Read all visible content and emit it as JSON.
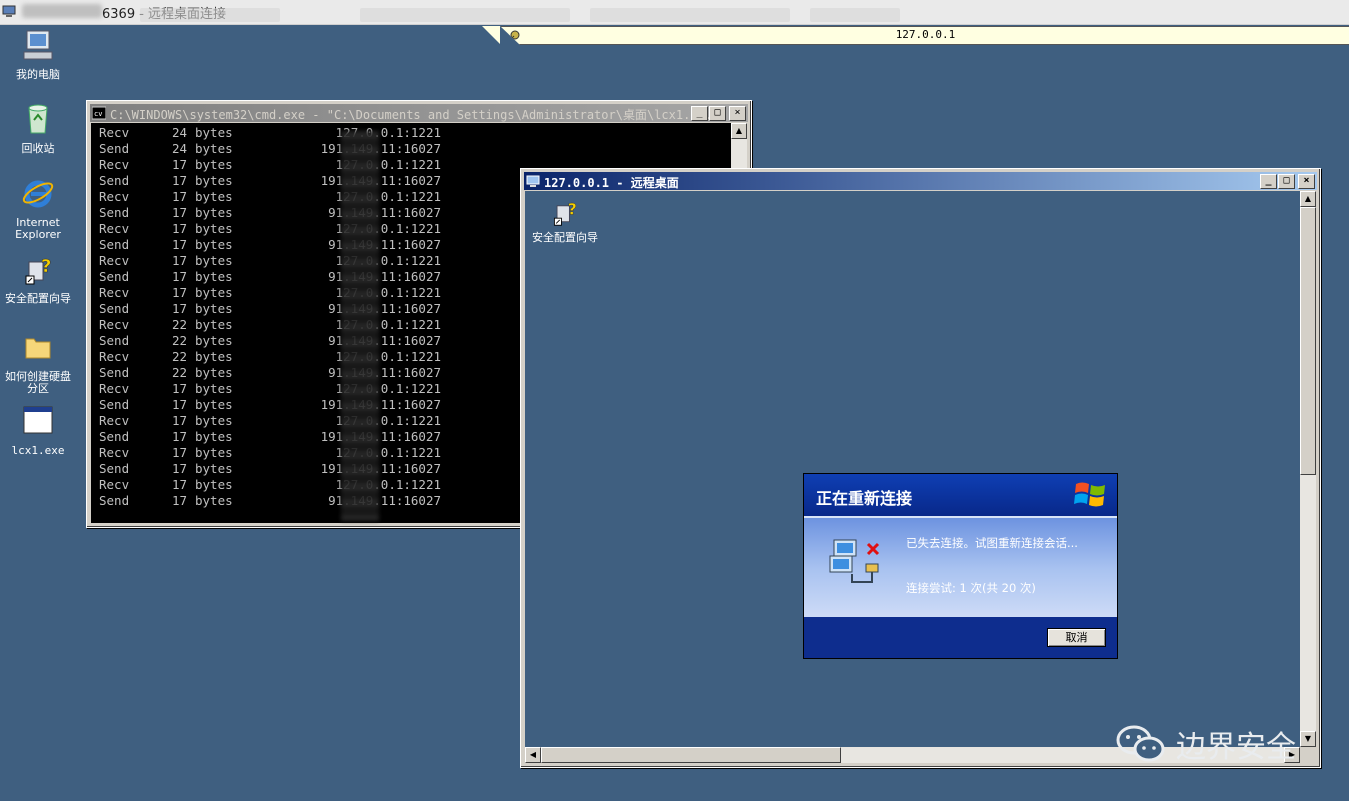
{
  "host": {
    "title_suffix": "6369 - 远程桌面连接"
  },
  "connection_bar": {
    "address": "127.0.0.1"
  },
  "desktop": {
    "icons": [
      {
        "label": "我的电脑",
        "icon": "computer-icon"
      },
      {
        "label": "回收站",
        "icon": "recycle-bin-icon"
      },
      {
        "label": "Internet Explorer",
        "icon": "internet-explorer-icon"
      },
      {
        "label": "安全配置向导",
        "icon": "security-wizard-icon"
      },
      {
        "label": "如何创建硬盘分区",
        "icon": "folder-icon"
      },
      {
        "label": "lcx1.exe",
        "icon": "exe-window-icon"
      }
    ]
  },
  "cmd_window": {
    "title": "C:\\WINDOWS\\system32\\cmd.exe - \"C:\\Documents and Settings\\Administrator\\桌面\\lcx1....",
    "lines": [
      {
        "dir": "Recv",
        "num": "24",
        "unit": "bytes",
        "addr": "127.0.0.1:1221"
      },
      {
        "dir": "Send",
        "num": "24",
        "unit": "bytes",
        "addr": "191.149.11:16027"
      },
      {
        "dir": "Recv",
        "num": "17",
        "unit": "bytes",
        "addr": "127.0.0.1:1221"
      },
      {
        "dir": "Send",
        "num": "17",
        "unit": "bytes",
        "addr": "191.149.11:16027"
      },
      {
        "dir": "Recv",
        "num": "17",
        "unit": "bytes",
        "addr": "127.0.0.1:1221"
      },
      {
        "dir": "Send",
        "num": "17",
        "unit": "bytes",
        "addr": "91.149.11:16027"
      },
      {
        "dir": "Recv",
        "num": "17",
        "unit": "bytes",
        "addr": "127.0.0.1:1221"
      },
      {
        "dir": "Send",
        "num": "17",
        "unit": "bytes",
        "addr": "91.149.11:16027"
      },
      {
        "dir": "Recv",
        "num": "17",
        "unit": "bytes",
        "addr": "127.0.0.1:1221"
      },
      {
        "dir": "Send",
        "num": "17",
        "unit": "bytes",
        "addr": "91.149.11:16027"
      },
      {
        "dir": "Recv",
        "num": "17",
        "unit": "bytes",
        "addr": "127.0.0.1:1221"
      },
      {
        "dir": "Send",
        "num": "17",
        "unit": "bytes",
        "addr": "91.149.11:16027"
      },
      {
        "dir": "Recv",
        "num": "22",
        "unit": "bytes",
        "addr": "127.0.0.1:1221"
      },
      {
        "dir": "Send",
        "num": "22",
        "unit": "bytes",
        "addr": "91.149.11:16027"
      },
      {
        "dir": "Recv",
        "num": "22",
        "unit": "bytes",
        "addr": "127.0.0.1:1221"
      },
      {
        "dir": "Send",
        "num": "22",
        "unit": "bytes",
        "addr": "91.149.11:16027"
      },
      {
        "dir": "Recv",
        "num": "17",
        "unit": "bytes",
        "addr": "127.0.0.1:1221"
      },
      {
        "dir": "Send",
        "num": "17",
        "unit": "bytes",
        "addr": "191.149.11:16027"
      },
      {
        "dir": "Recv",
        "num": "17",
        "unit": "bytes",
        "addr": "127.0.0.1:1221"
      },
      {
        "dir": "Send",
        "num": "17",
        "unit": "bytes",
        "addr": "191.149.11:16027"
      },
      {
        "dir": "Recv",
        "num": "17",
        "unit": "bytes",
        "addr": "127.0.0.1:1221"
      },
      {
        "dir": "Send",
        "num": "17",
        "unit": "bytes",
        "addr": "191.149.11:16027"
      },
      {
        "dir": "Recv",
        "num": "17",
        "unit": "bytes",
        "addr": "127.0.0.1:1221"
      },
      {
        "dir": "Send",
        "num": "17",
        "unit": "bytes",
        "addr": "91.149.11:16027"
      }
    ]
  },
  "remote_window": {
    "title": "127.0.0.1 - 远程桌面",
    "desktop_icon_label": "安全配置向导"
  },
  "reconnect_dialog": {
    "title": "正在重新连接",
    "message": "已失去连接。试图重新连接会话...",
    "attempt": "连接尝试: 1 次(共 20 次)",
    "cancel_label": "取消"
  },
  "watermark": {
    "text": "边界安全"
  },
  "colors": {
    "desktop": "#3f5f80",
    "dialog_blue": "#0a3aa8",
    "console_bg": "#000000",
    "console_fg": "#c0c0c0"
  }
}
